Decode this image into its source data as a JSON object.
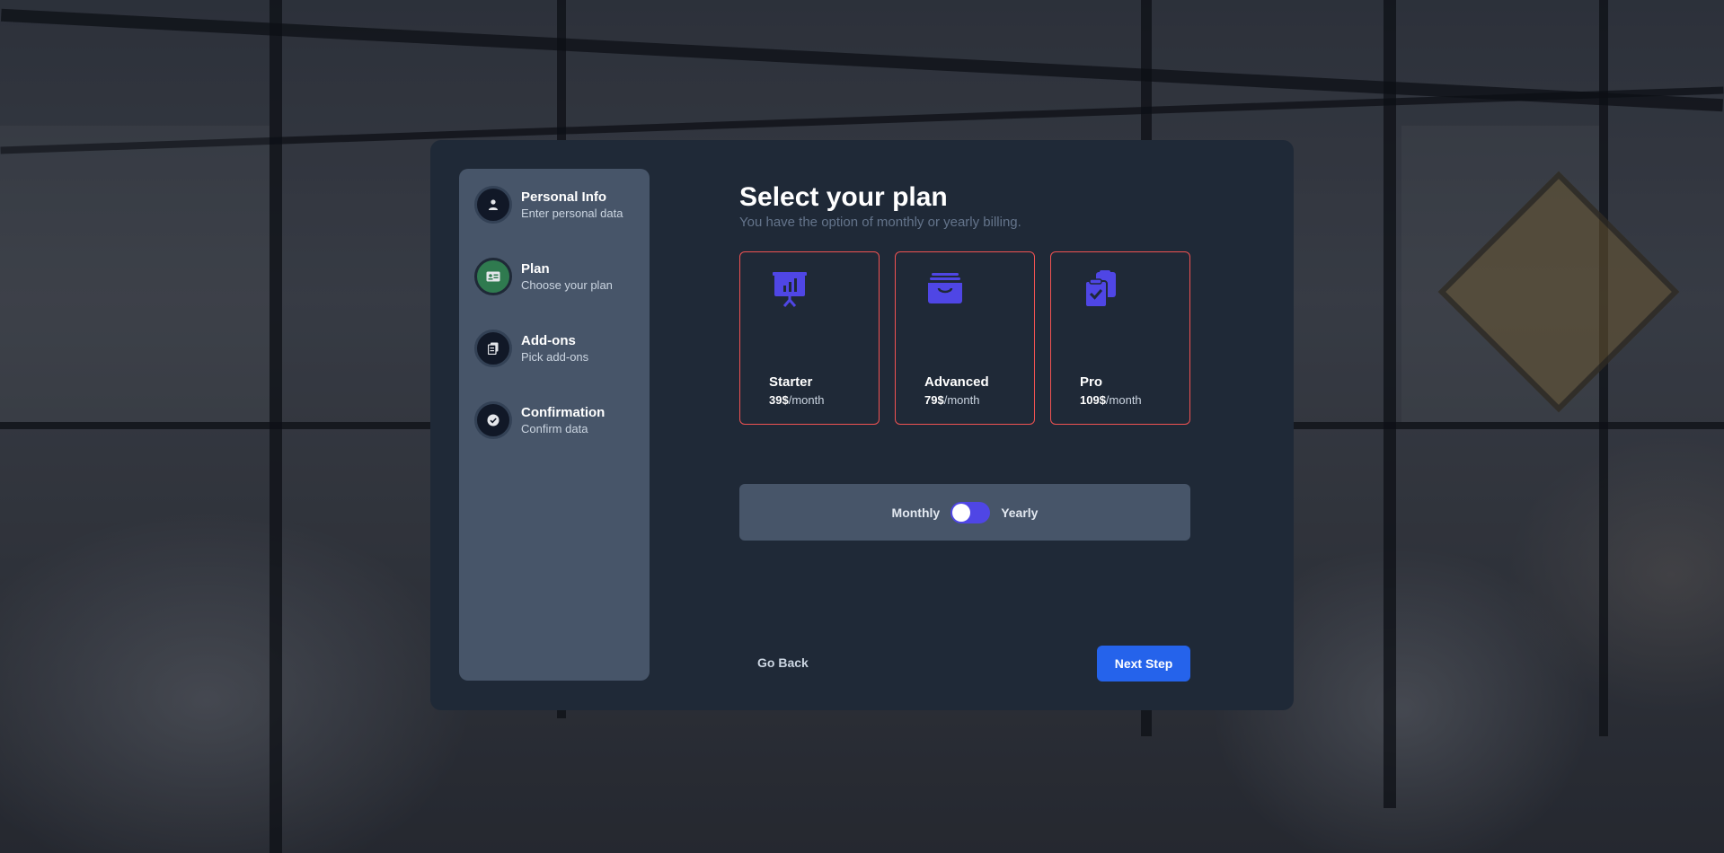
{
  "sidebar": {
    "steps": [
      {
        "title": "Personal Info",
        "subtitle": "Enter personal data",
        "icon": "user-icon"
      },
      {
        "title": "Plan",
        "subtitle": "Choose your plan",
        "icon": "id-card-icon",
        "active": true
      },
      {
        "title": "Add-ons",
        "subtitle": "Pick add-ons",
        "icon": "copy-icon"
      },
      {
        "title": "Confirmation",
        "subtitle": "Confirm data",
        "icon": "check-circle-icon"
      }
    ]
  },
  "main": {
    "title": "Select your plan",
    "subtitle": "You have the option of monthly or yearly billing.",
    "plans": [
      {
        "name": "Starter",
        "price": "39$",
        "period": "/month",
        "icon": "presentation-chart-icon"
      },
      {
        "name": "Advanced",
        "price": "79$",
        "period": "/month",
        "icon": "archive-box-icon"
      },
      {
        "name": "Pro",
        "price": "109$",
        "period": "/month",
        "icon": "clipboard-check-icon"
      }
    ],
    "billing": {
      "monthly_label": "Monthly",
      "yearly_label": "Yearly",
      "selected": "Monthly"
    }
  },
  "footer": {
    "back_label": "Go Back",
    "next_label": "Next Step"
  },
  "colors": {
    "accent": "#4f46e5",
    "plan_border": "#f05252",
    "next_button": "#2563eb",
    "active_step": "#2f7a4f"
  }
}
